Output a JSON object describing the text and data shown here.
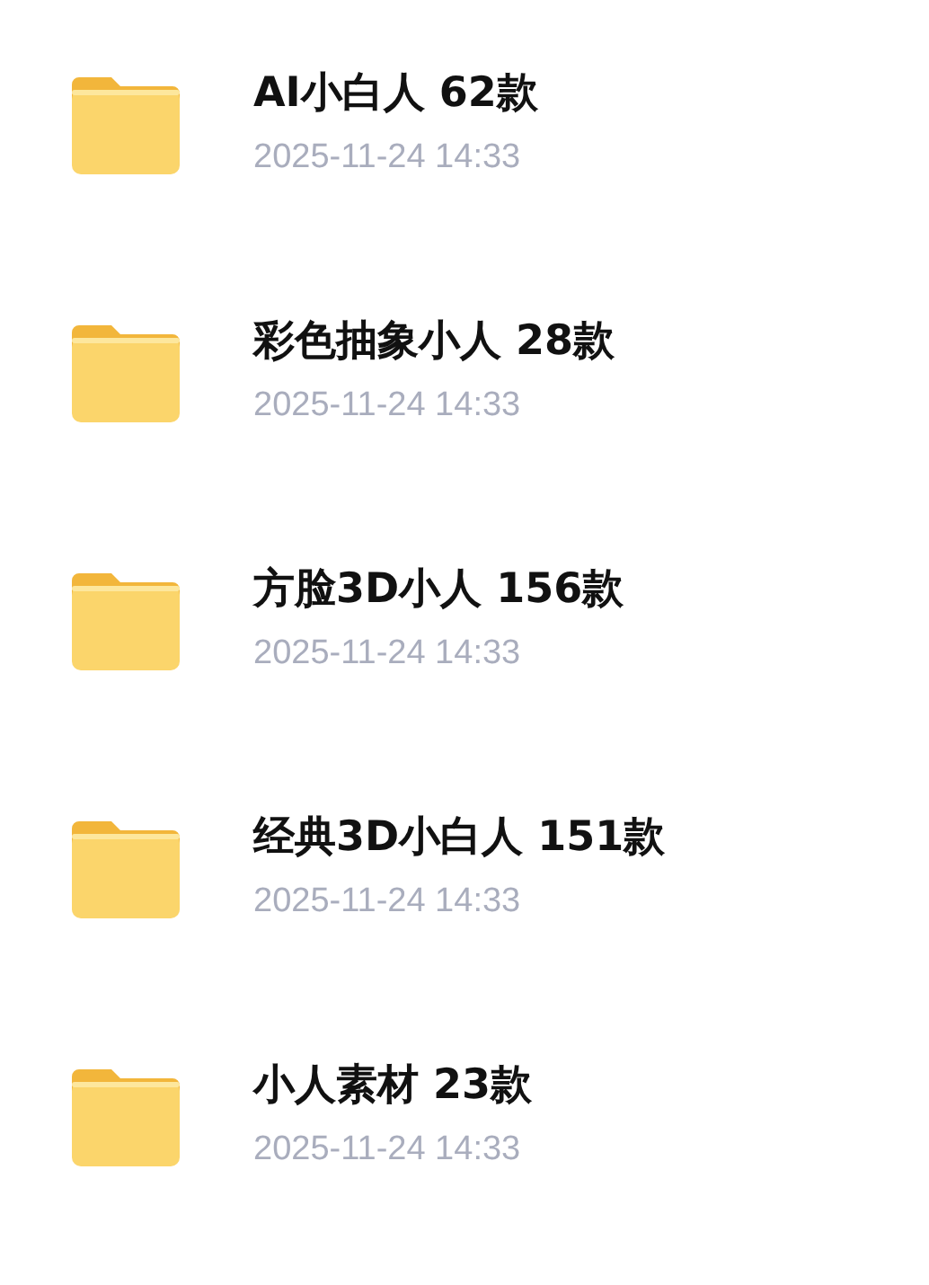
{
  "folders": [
    {
      "name": "AI小白人 62款",
      "date": "2025-11-24 14:33"
    },
    {
      "name": "彩色抽象小人 28款",
      "date": "2025-11-24 14:33"
    },
    {
      "name": "方脸3D小人 156款",
      "date": "2025-11-24 14:33"
    },
    {
      "name": "经典3D小白人 151款",
      "date": "2025-11-24 14:33"
    },
    {
      "name": "小人素材 23款",
      "date": "2025-11-24 14:33"
    }
  ]
}
